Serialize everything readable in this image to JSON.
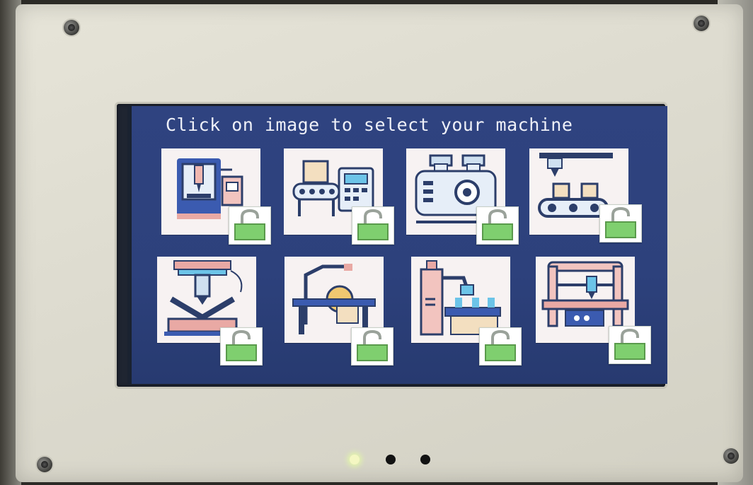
{
  "screen": {
    "title": "Click on image to select your machine",
    "background_color": "#2f4380",
    "accent_color": "#7fcf6f"
  },
  "machines": [
    {
      "icon": "cnc-milling-machine-icon",
      "lock_state": "unlocked"
    },
    {
      "icon": "packaging-conveyor-machine-icon",
      "lock_state": "unlocked"
    },
    {
      "icon": "industrial-gear-machine-icon",
      "lock_state": "unlocked"
    },
    {
      "icon": "robotic-conveyor-line-icon",
      "lock_state": "unlocked"
    },
    {
      "icon": "hydraulic-press-machine-icon",
      "lock_state": "unlocked"
    },
    {
      "icon": "table-saw-machine-icon",
      "lock_state": "unlocked"
    },
    {
      "icon": "robot-arm-assembly-icon",
      "lock_state": "unlocked"
    },
    {
      "icon": "cnc-router-gantry-icon",
      "lock_state": "unlocked"
    }
  ],
  "page_indicator": {
    "current": 1,
    "total": 3
  }
}
